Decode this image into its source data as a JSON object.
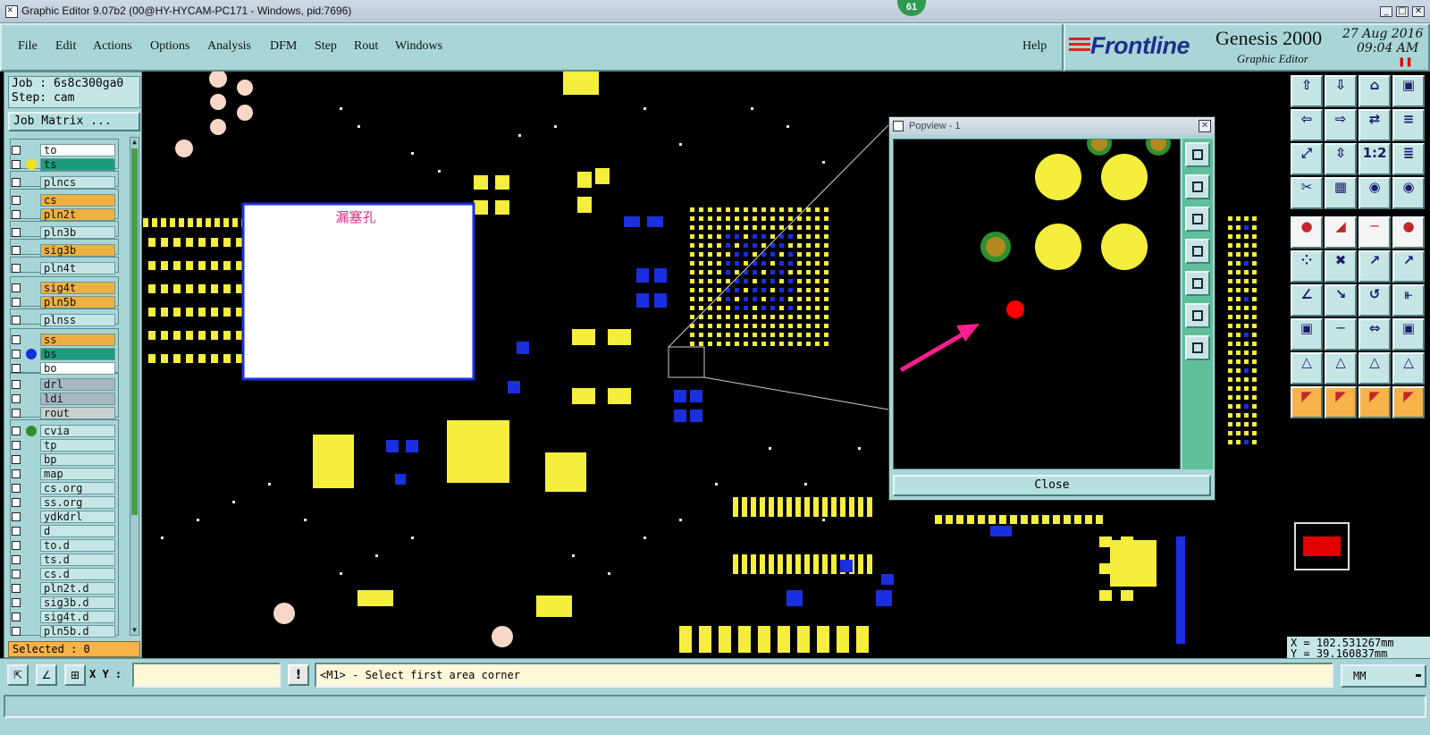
{
  "window": {
    "title": "Graphic Editor 9.07b2 (00@HY-HYCAM-PC171 - Windows, pid:7696)",
    "badge": "61"
  },
  "menu": {
    "items": [
      "File",
      "Edit",
      "Actions",
      "Options",
      "Analysis",
      "DFM",
      "Step",
      "Rout",
      "Windows"
    ],
    "help": "Help"
  },
  "logo": {
    "brand": "Frontline",
    "product": "Genesis 2000",
    "subtitle": "Graphic Editor",
    "date": "27 Aug 2016",
    "time": "09:04 AM"
  },
  "job": {
    "job_line": "Job : 6s8c300ga0",
    "step_line": "Step: cam",
    "matrix_button": "Job Matrix ..."
  },
  "layers": [
    {
      "name": "to",
      "bg": "#ffffff",
      "dot": ""
    },
    {
      "name": "ts",
      "bg": "#1c9c7c",
      "dot": "#f0e020"
    },
    {
      "name": "plncs",
      "bg": "#c6e6e6",
      "dot": ""
    },
    {
      "name": "cs",
      "bg": "#f0b040",
      "dot": ""
    },
    {
      "name": "pln2t",
      "bg": "#f0b040",
      "dot": ""
    },
    {
      "name": "pln3b",
      "bg": "#c6e6e6",
      "dot": ""
    },
    {
      "name": "sig3b",
      "bg": "#f0b040",
      "dot": ""
    },
    {
      "name": "pln4t",
      "bg": "#c6e6e6",
      "dot": ""
    },
    {
      "name": "sig4t",
      "bg": "#f0b040",
      "dot": ""
    },
    {
      "name": "pln5b",
      "bg": "#f0b040",
      "dot": ""
    },
    {
      "name": "plnss",
      "bg": "#c6e6e6",
      "dot": ""
    },
    {
      "name": "ss",
      "bg": "#f0b040",
      "dot": ""
    },
    {
      "name": "bs",
      "bg": "#1c9c7c",
      "dot": "#1030e0"
    },
    {
      "name": "bo",
      "bg": "#ffffff",
      "dot": ""
    },
    {
      "name": "drl",
      "bg": "#a8b8c0",
      "dot": ""
    },
    {
      "name": "ldi",
      "bg": "#a8b8c0",
      "dot": ""
    },
    {
      "name": "rout",
      "bg": "#c8d0d0",
      "dot": ""
    },
    {
      "name": "cvia",
      "bg": "#c6e6e6",
      "dot": "#2f8f2f"
    },
    {
      "name": "tp",
      "bg": "#c6e6e6",
      "dot": ""
    },
    {
      "name": "bp",
      "bg": "#c6e6e6",
      "dot": ""
    },
    {
      "name": "map",
      "bg": "#c6e6e6",
      "dot": ""
    },
    {
      "name": "cs.org",
      "bg": "#c6e6e6",
      "dot": ""
    },
    {
      "name": "ss.org",
      "bg": "#c6e6e6",
      "dot": ""
    },
    {
      "name": "ydkdrl",
      "bg": "#c6e6e6",
      "dot": ""
    },
    {
      "name": "d",
      "bg": "#c6e6e6",
      "dot": ""
    },
    {
      "name": "to.d",
      "bg": "#c6e6e6",
      "dot": ""
    },
    {
      "name": "ts.d",
      "bg": "#c6e6e6",
      "dot": ""
    },
    {
      "name": "cs.d",
      "bg": "#c6e6e6",
      "dot": ""
    },
    {
      "name": "pln2t.d",
      "bg": "#c6e6e6",
      "dot": ""
    },
    {
      "name": "sig3b.d",
      "bg": "#c6e6e6",
      "dot": ""
    },
    {
      "name": "sig4t.d",
      "bg": "#c6e6e6",
      "dot": ""
    },
    {
      "name": "pln5b.d",
      "bg": "#c6e6e6",
      "dot": ""
    }
  ],
  "selected": "Selected : 0",
  "canvas": {
    "note_label": "漏塞孔"
  },
  "popview": {
    "title": "Popview - 1",
    "close_label": "Close"
  },
  "coords": {
    "x": "X = 102.531267mm",
    "y": "Y = 39.160837mm"
  },
  "bottom": {
    "xy_label": "X Y :",
    "xy_value": "",
    "warn_glyph": "!",
    "prompt": "<M1> - Select first area corner",
    "units": "MM"
  },
  "colors": {
    "pad_yellow": "#f5ee3c",
    "pad_blue": "#1a2fe0",
    "panel_teal": "#a8d6d6",
    "arrow_pink": "#ff1e8c",
    "via_red": "#ff0000",
    "via_green": "#2f8f2f"
  }
}
